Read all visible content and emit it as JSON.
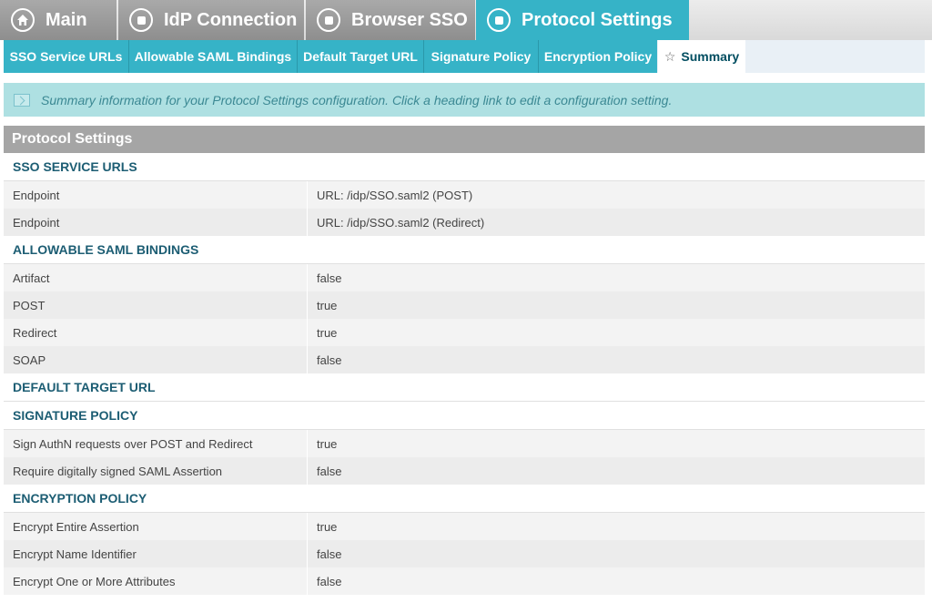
{
  "top_tabs": [
    {
      "label": "Main",
      "icon": "home-icon"
    },
    {
      "label": "IdP Connection",
      "icon": "step-icon"
    },
    {
      "label": "Browser SSO",
      "icon": "step-icon"
    },
    {
      "label": "Protocol Settings",
      "icon": "step-icon",
      "active": true
    }
  ],
  "sub_tabs": [
    {
      "label": "SSO Service URLs"
    },
    {
      "label": "Allowable SAML Bindings"
    },
    {
      "label": "Default Target URL"
    },
    {
      "label": "Signature Policy"
    },
    {
      "label": "Encryption Policy"
    },
    {
      "label": "Summary",
      "active": true,
      "icon": "star-icon"
    }
  ],
  "info": {
    "text": "Summary information for your Protocol Settings configuration. Click a heading link to edit a configuration setting."
  },
  "summary": {
    "title": "Protocol Settings",
    "sections": [
      {
        "heading": "SSO SERVICE URLS",
        "rows": [
          {
            "label": "Endpoint",
            "value": "URL: /idp/SSO.saml2 (POST)"
          },
          {
            "label": "Endpoint",
            "value": "URL: /idp/SSO.saml2 (Redirect)"
          }
        ]
      },
      {
        "heading": "ALLOWABLE SAML BINDINGS",
        "rows": [
          {
            "label": "Artifact",
            "value": "false"
          },
          {
            "label": "POST",
            "value": "true"
          },
          {
            "label": "Redirect",
            "value": "true"
          },
          {
            "label": "SOAP",
            "value": "false"
          }
        ]
      },
      {
        "heading": "DEFAULT TARGET URL",
        "rows": []
      },
      {
        "heading": "SIGNATURE POLICY",
        "rows": [
          {
            "label": "Sign AuthN requests over POST and Redirect",
            "value": "true"
          },
          {
            "label": "Require digitally signed SAML Assertion",
            "value": "false"
          }
        ]
      },
      {
        "heading": "ENCRYPTION POLICY",
        "rows": [
          {
            "label": "Encrypt Entire Assertion",
            "value": "true"
          },
          {
            "label": "Encrypt Name Identifier",
            "value": "false"
          },
          {
            "label": "Encrypt One or More Attributes",
            "value": "false"
          }
        ]
      }
    ]
  },
  "colors": {
    "accent": "#36b3c7",
    "inactive_tab": "#999999",
    "section_heading": "#1c5d73",
    "info_banner": "#aee0e2"
  }
}
